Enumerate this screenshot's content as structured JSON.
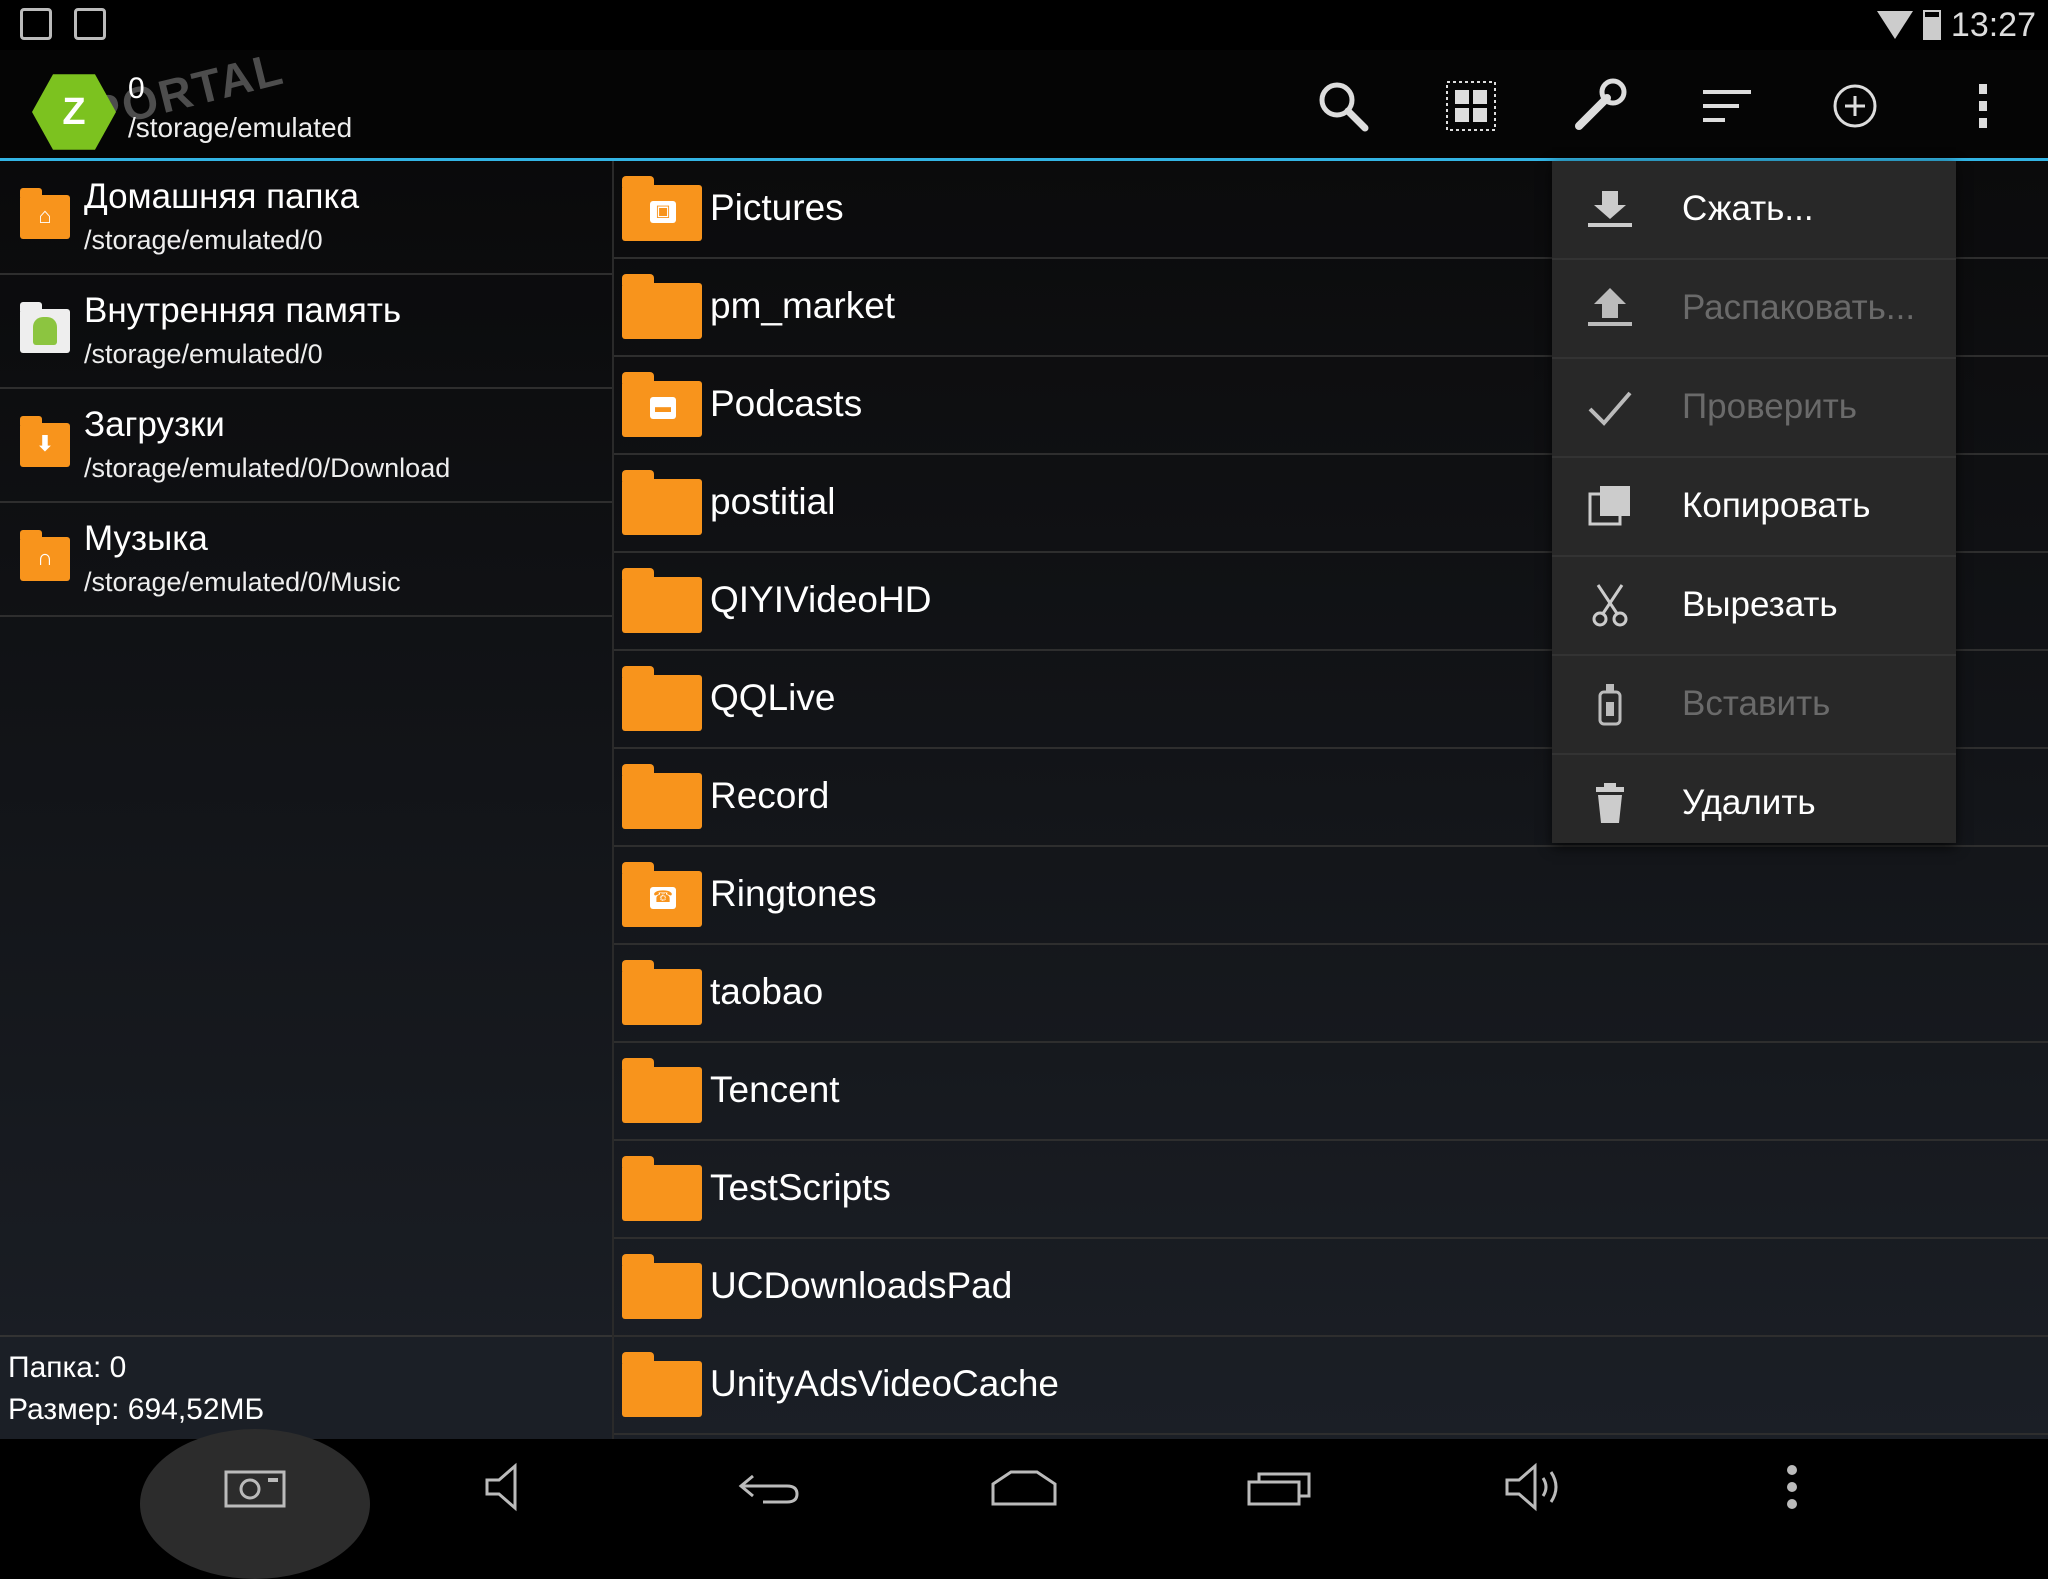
{
  "status_bar": {
    "time": "13:27"
  },
  "header": {
    "folder_count": "0",
    "path": "/storage/emulated",
    "logo_text": "PORTAL",
    "logo_mark": "Z"
  },
  "toolbar": {
    "icons": [
      "search-icon",
      "select-grid-icon",
      "tools-icon",
      "sort-icon",
      "add-icon",
      "overflow-menu-icon"
    ]
  },
  "sidebar": {
    "bookmarks": [
      {
        "title": "Домашняя папка",
        "path": "/storage/emulated/0",
        "icon": "home-folder-icon"
      },
      {
        "title": "Внутренняя память",
        "path": "/storage/emulated/0",
        "icon": "android-storage-icon"
      },
      {
        "title": "Загрузки",
        "path": "/storage/emulated/0/Download",
        "icon": "download-folder-icon"
      },
      {
        "title": "Музыка",
        "path": "/storage/emulated/0/Music",
        "icon": "music-folder-icon"
      }
    ],
    "footer": {
      "folder_line": "Папка: 0",
      "size_line": "Размер: 694,52МБ"
    }
  },
  "files": [
    {
      "name": "Pictures",
      "badge": "▣"
    },
    {
      "name": "pm_market",
      "badge": ""
    },
    {
      "name": "Podcasts",
      "badge": "▬"
    },
    {
      "name": "postitial",
      "badge": ""
    },
    {
      "name": "QIYIVideoHD",
      "badge": ""
    },
    {
      "name": "QQLive",
      "badge": ""
    },
    {
      "name": "Record",
      "badge": ""
    },
    {
      "name": "Ringtones",
      "badge": "☎"
    },
    {
      "name": "taobao",
      "badge": ""
    },
    {
      "name": "Tencent",
      "badge": ""
    },
    {
      "name": "TestScripts",
      "badge": ""
    },
    {
      "name": "UCDownloadsPad",
      "badge": ""
    },
    {
      "name": "UnityAdsVideoCache",
      "badge": ""
    }
  ],
  "context_menu": [
    {
      "label": "Сжать...",
      "enabled": true,
      "icon": "compress-icon"
    },
    {
      "label": "Распаковать...",
      "enabled": false,
      "icon": "extract-icon"
    },
    {
      "label": "Проверить",
      "enabled": false,
      "icon": "check-icon"
    },
    {
      "label": "Копировать",
      "enabled": true,
      "icon": "copy-icon"
    },
    {
      "label": "Вырезать",
      "enabled": true,
      "icon": "cut-icon"
    },
    {
      "label": "Вставить",
      "enabled": false,
      "icon": "paste-icon"
    },
    {
      "label": "Удалить",
      "enabled": true,
      "icon": "delete-icon"
    }
  ],
  "colors": {
    "accent": "#33b5e5",
    "folder": "#f8941c",
    "menu_bg": "#282828",
    "disabled_text": "#6a6a6a"
  }
}
